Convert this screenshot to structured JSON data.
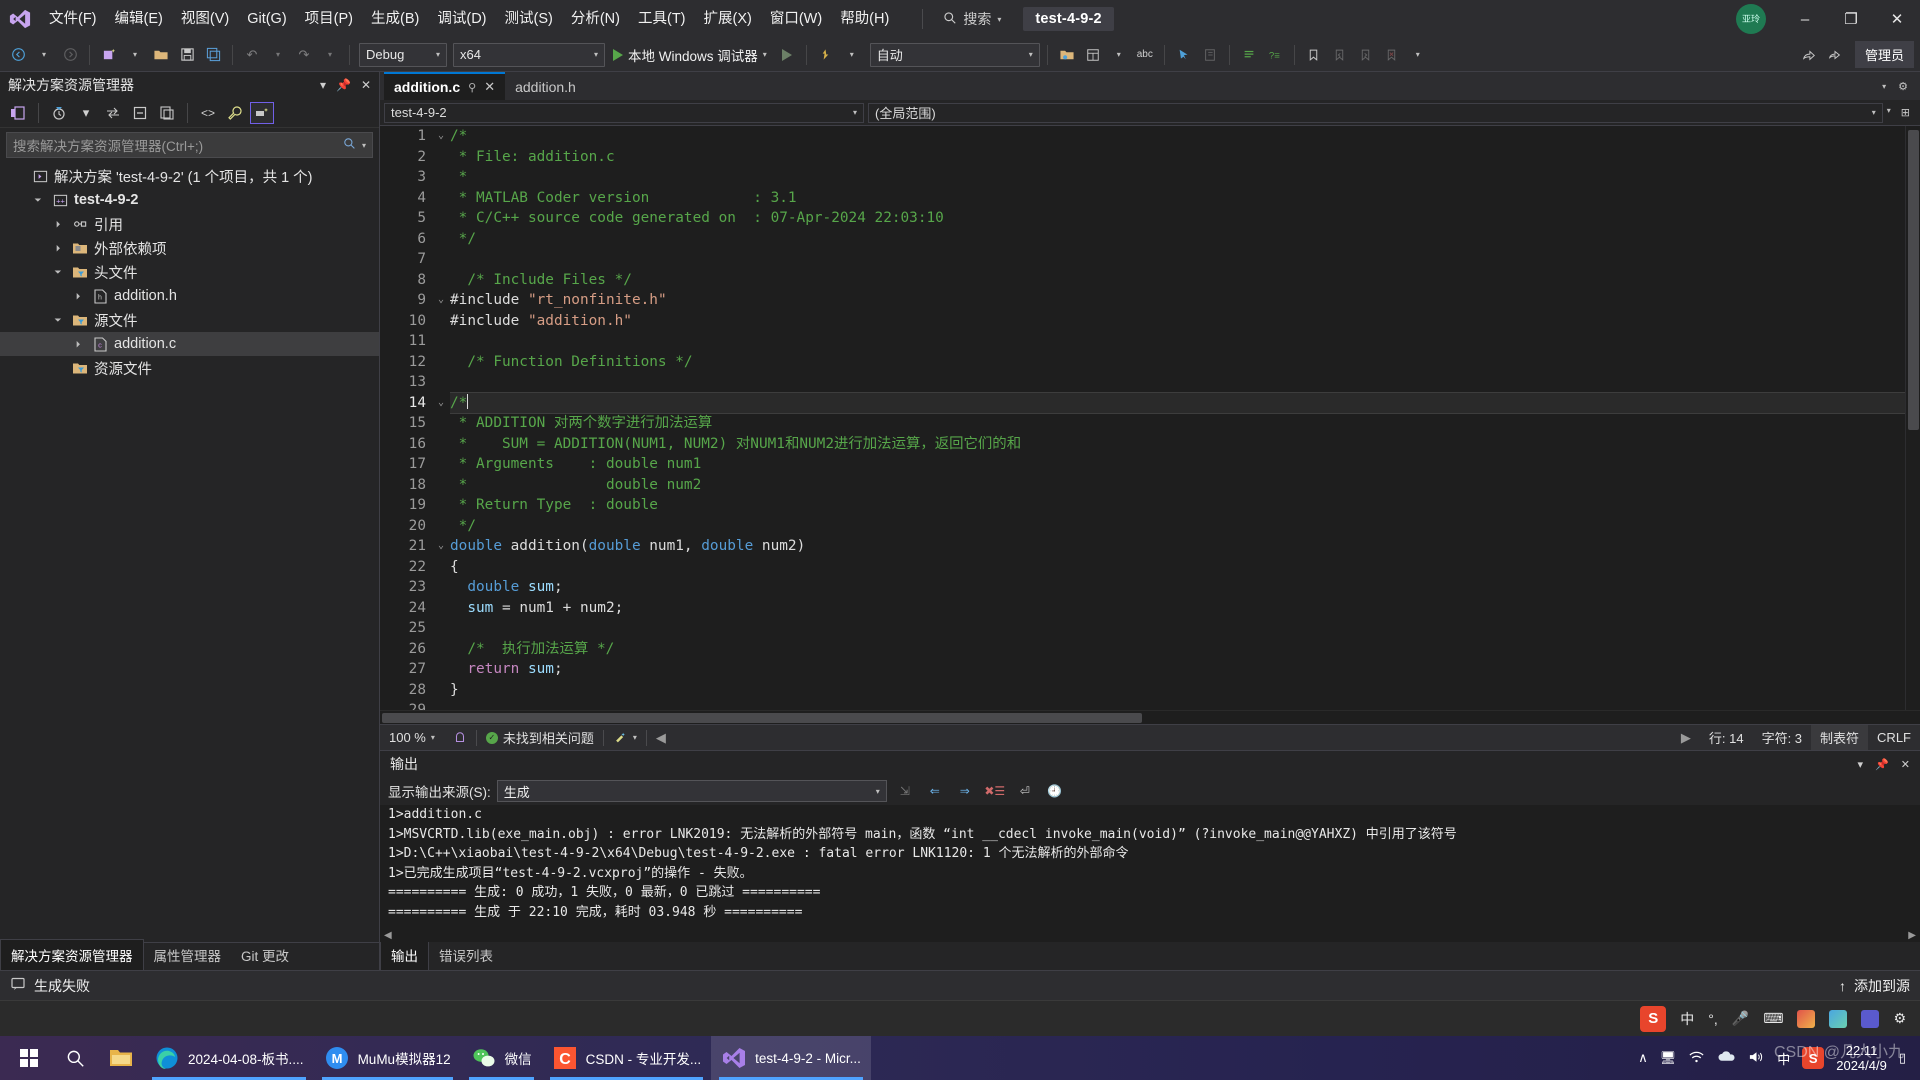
{
  "window": {
    "title": "test-4-9-2",
    "search_placeholder": "搜索",
    "admin_label": "管理员",
    "avatar_initials": "亚玲",
    "minimize": "–",
    "restore": "❐",
    "close": "✕"
  },
  "menu": [
    {
      "label": "文件(F)"
    },
    {
      "label": "编辑(E)"
    },
    {
      "label": "视图(V)"
    },
    {
      "label": "Git(G)"
    },
    {
      "label": "项目(P)"
    },
    {
      "label": "生成(B)"
    },
    {
      "label": "调试(D)"
    },
    {
      "label": "测试(S)"
    },
    {
      "label": "分析(N)"
    },
    {
      "label": "工具(T)"
    },
    {
      "label": "扩展(X)"
    },
    {
      "label": "窗口(W)"
    },
    {
      "label": "帮助(H)"
    }
  ],
  "toolbar": {
    "config": "Debug",
    "platform": "x64",
    "debug_target": "本地 Windows 调试器",
    "auto": "自动"
  },
  "solution_explorer": {
    "title": "解决方案资源管理器",
    "search_placeholder": "搜索解决方案资源管理器(Ctrl+;)",
    "tree": [
      {
        "indent": 0,
        "twisty": "",
        "icon": "solution-icon",
        "label": "解决方案 'test-4-9-2' (1 个项目，共 1 个)",
        "bold": false,
        "selected": false
      },
      {
        "indent": 1,
        "twisty": "▲",
        "icon": "cpp-project-icon",
        "label": "test-4-9-2",
        "bold": true,
        "selected": false
      },
      {
        "indent": 2,
        "twisty": "▶",
        "icon": "references-icon",
        "label": "引用",
        "bold": false,
        "selected": false
      },
      {
        "indent": 2,
        "twisty": "▶",
        "icon": "folder-icon",
        "label": "外部依赖项",
        "bold": false,
        "selected": false
      },
      {
        "indent": 2,
        "twisty": "▲",
        "icon": "filter-folder-icon",
        "label": "头文件",
        "bold": false,
        "selected": false
      },
      {
        "indent": 3,
        "twisty": "▶",
        "icon": "header-file-icon",
        "label": "addition.h",
        "bold": false,
        "selected": false
      },
      {
        "indent": 2,
        "twisty": "▲",
        "icon": "filter-folder-icon",
        "label": "源文件",
        "bold": false,
        "selected": false
      },
      {
        "indent": 3,
        "twisty": "▶",
        "icon": "c-file-icon",
        "label": "addition.c",
        "bold": false,
        "selected": true
      },
      {
        "indent": 2,
        "twisty": "",
        "icon": "filter-folder-icon",
        "label": "资源文件",
        "bold": false,
        "selected": false
      }
    ],
    "bottom_tabs": [
      {
        "label": "解决方案资源管理器",
        "active": true
      },
      {
        "label": "属性管理器",
        "active": false
      },
      {
        "label": "Git 更改",
        "active": false
      }
    ]
  },
  "editor": {
    "tabs": [
      {
        "label": "addition.c",
        "active": true,
        "pinned": true,
        "closable": true
      },
      {
        "label": "addition.h",
        "active": false,
        "pinned": false,
        "closable": false
      }
    ],
    "nav_left": "test-4-9-2",
    "nav_right": "(全局范围)",
    "zoom": "100 %",
    "issue_status": "未找到相关问题",
    "line_label": "行: 14",
    "col_label": "字符: 3",
    "tabs_label": "制表符",
    "eol_label": "CRLF",
    "lines": [
      {
        "n": 1,
        "fold": "⌄",
        "current": false,
        "tokens": [
          {
            "t": "/*",
            "c": "g"
          }
        ]
      },
      {
        "n": 2,
        "fold": "",
        "current": false,
        "tokens": [
          {
            "t": " * File: addition.c",
            "c": "g"
          }
        ]
      },
      {
        "n": 3,
        "fold": "",
        "current": false,
        "tokens": [
          {
            "t": " *",
            "c": "g"
          }
        ]
      },
      {
        "n": 4,
        "fold": "",
        "current": false,
        "tokens": [
          {
            "t": " * MATLAB Coder version            : 3.1",
            "c": "g"
          }
        ]
      },
      {
        "n": 5,
        "fold": "",
        "current": false,
        "tokens": [
          {
            "t": " * C/C++ source code generated on  : 07-Apr-2024 22:03:10",
            "c": "g"
          }
        ]
      },
      {
        "n": 6,
        "fold": "",
        "current": false,
        "tokens": [
          {
            "t": " */",
            "c": "g"
          }
        ]
      },
      {
        "n": 7,
        "fold": "",
        "current": false,
        "tokens": []
      },
      {
        "n": 8,
        "fold": "",
        "current": false,
        "tokens": [
          {
            "t": "  /* Include Files */",
            "c": "g"
          }
        ]
      },
      {
        "n": 9,
        "fold": "⌄",
        "current": false,
        "tokens": [
          {
            "t": "#include ",
            "c": "w"
          },
          {
            "t": "\"rt_nonfinite.h\"",
            "c": "o"
          }
        ]
      },
      {
        "n": 10,
        "fold": "",
        "current": false,
        "tokens": [
          {
            "t": "#include ",
            "c": "w"
          },
          {
            "t": "\"addition.h\"",
            "c": "o"
          }
        ]
      },
      {
        "n": 11,
        "fold": "",
        "current": false,
        "tokens": []
      },
      {
        "n": 12,
        "fold": "",
        "current": false,
        "tokens": [
          {
            "t": "  /* Function Definitions */",
            "c": "g"
          }
        ]
      },
      {
        "n": 13,
        "fold": "",
        "current": false,
        "tokens": []
      },
      {
        "n": 14,
        "fold": "⌄",
        "current": true,
        "tokens": [
          {
            "t": "/*",
            "c": "g"
          }
        ],
        "cursor": true
      },
      {
        "n": 15,
        "fold": "",
        "current": false,
        "tokens": [
          {
            "t": " * ADDITION 对两个数字进行加法运算",
            "c": "g"
          }
        ]
      },
      {
        "n": 16,
        "fold": "",
        "current": false,
        "tokens": [
          {
            "t": " *    SUM = ADDITION(NUM1, NUM2) 对NUM1和NUM2进行加法运算，返回它们的和",
            "c": "g"
          }
        ]
      },
      {
        "n": 17,
        "fold": "",
        "current": false,
        "tokens": [
          {
            "t": " * Arguments    : double num1",
            "c": "g"
          }
        ]
      },
      {
        "n": 18,
        "fold": "",
        "current": false,
        "tokens": [
          {
            "t": " *                double num2",
            "c": "g"
          }
        ]
      },
      {
        "n": 19,
        "fold": "",
        "current": false,
        "tokens": [
          {
            "t": " * Return Type  : double",
            "c": "g"
          }
        ]
      },
      {
        "n": 20,
        "fold": "",
        "current": false,
        "tokens": [
          {
            "t": " */",
            "c": "g"
          }
        ]
      },
      {
        "n": 21,
        "fold": "⌄",
        "current": false,
        "tokens": [
          {
            "t": "double",
            "c": "b"
          },
          {
            "t": " addition(",
            "c": "w"
          },
          {
            "t": "double",
            "c": "b"
          },
          {
            "t": " num1, ",
            "c": "w"
          },
          {
            "t": "double",
            "c": "b"
          },
          {
            "t": " num2)",
            "c": "w"
          }
        ]
      },
      {
        "n": 22,
        "fold": "",
        "current": false,
        "tokens": [
          {
            "t": "{",
            "c": "w"
          }
        ]
      },
      {
        "n": 23,
        "fold": "",
        "current": false,
        "tokens": [
          {
            "t": "  ",
            "c": "w"
          },
          {
            "t": "double",
            "c": "b"
          },
          {
            "t": " ",
            "c": "w"
          },
          {
            "t": "sum",
            "c": "lb"
          },
          {
            "t": ";",
            "c": "w"
          }
        ]
      },
      {
        "n": 24,
        "fold": "",
        "current": false,
        "tokens": [
          {
            "t": "  ",
            "c": "w"
          },
          {
            "t": "sum",
            "c": "lb"
          },
          {
            "t": " = num1 + num2;",
            "c": "w"
          }
        ]
      },
      {
        "n": 25,
        "fold": "",
        "current": false,
        "tokens": []
      },
      {
        "n": 26,
        "fold": "",
        "current": false,
        "tokens": [
          {
            "t": "  /*  执行加法运算 */",
            "c": "g"
          }
        ]
      },
      {
        "n": 27,
        "fold": "",
        "current": false,
        "tokens": [
          {
            "t": "  ",
            "c": "w"
          },
          {
            "t": "return",
            "c": "p"
          },
          {
            "t": " ",
            "c": "w"
          },
          {
            "t": "sum",
            "c": "lb"
          },
          {
            "t": ";",
            "c": "w"
          }
        ]
      },
      {
        "n": 28,
        "fold": "",
        "current": false,
        "tokens": [
          {
            "t": "}",
            "c": "w"
          }
        ]
      },
      {
        "n": 29,
        "fold": "",
        "current": false,
        "tokens": []
      }
    ]
  },
  "output": {
    "title": "输出",
    "source_label": "显示输出来源(S):",
    "source_value": "生成",
    "lines": [
      "1>addition.c",
      "1>MSVCRTD.lib(exe_main.obj) : error LNK2019: 无法解析的外部符号 main，函数 “int __cdecl invoke_main(void)” (?invoke_main@@YAHXZ) 中引用了该符号",
      "1>D:\\C++\\xiaobai\\test-4-9-2\\x64\\Debug\\test-4-9-2.exe : fatal error LNK1120: 1 个无法解析的外部命令",
      "1>已完成生成项目“test-4-9-2.vcxproj”的操作 - 失败。",
      "========== 生成: 0 成功，1 失败，0 最新，0 已跳过 ==========",
      "========== 生成 于 22:10 完成，耗时 03.948 秒 =========="
    ],
    "tabs": [
      {
        "label": "输出",
        "active": true
      },
      {
        "label": "错误列表",
        "active": false
      }
    ]
  },
  "status_bar": {
    "message": "生成失败",
    "source_control": "添加到源"
  },
  "ime_bar": {
    "lang": "中",
    "brand": "S"
  },
  "taskbar": {
    "items": [
      {
        "label": "",
        "icon": "start-icon",
        "active": false,
        "open": false
      },
      {
        "label": "",
        "icon": "search-icon",
        "active": false,
        "open": false
      },
      {
        "label": "",
        "icon": "file-explorer-icon",
        "active": false,
        "open": false
      },
      {
        "label": "2024-04-08-板书....",
        "icon": "edge-icon",
        "active": false,
        "open": true
      },
      {
        "label": "MuMu模拟器12",
        "icon": "mumu-icon",
        "active": false,
        "open": true
      },
      {
        "label": "微信",
        "icon": "wechat-icon",
        "active": false,
        "open": true
      },
      {
        "label": "CSDN - 专业开发...",
        "icon": "csdn-icon",
        "active": false,
        "open": true
      },
      {
        "label": "test-4-9-2 - Micr...",
        "icon": "vs-icon",
        "active": true,
        "open": true
      }
    ],
    "tray": {
      "lang": "中",
      "time": "22:11",
      "date": "2024/4/9"
    },
    "watermark": "CSDN @几人小九"
  },
  "colors": {
    "accent": "#0078d4",
    "comment_green": "#57a64a",
    "keyword_blue": "#569cd6",
    "string_orange": "#d69d85",
    "chrome": "#2d2d30",
    "editor_bg": "#1e1e1e"
  }
}
